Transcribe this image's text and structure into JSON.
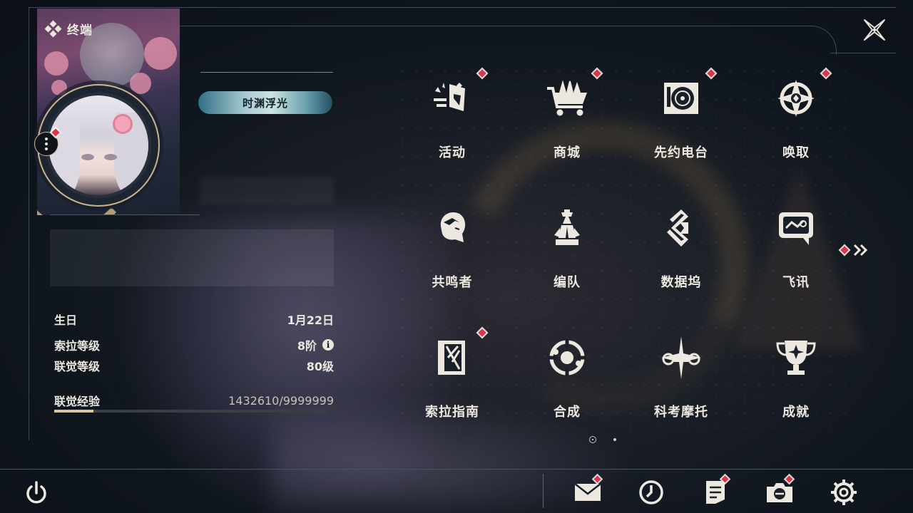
{
  "header": {
    "terminal_title": "终端"
  },
  "profile": {
    "title_badge": "时渊浮光",
    "stats": [
      {
        "key": "生日",
        "value": "1月22日"
      },
      {
        "key": "索拉等级",
        "value": "8阶"
      },
      {
        "key": "联觉等级",
        "value": "80级"
      }
    ],
    "exp": {
      "label": "联觉经验",
      "value": "1432610/9999999",
      "progress": 0.1433
    }
  },
  "menu": [
    {
      "label": "活动",
      "icon": "activity-icon",
      "badge": true
    },
    {
      "label": "商城",
      "icon": "shop-cart-icon",
      "badge": true
    },
    {
      "label": "先约电台",
      "icon": "radio-vinyl-icon",
      "badge": true
    },
    {
      "label": "唤取",
      "icon": "compass-star-icon",
      "badge": true
    },
    {
      "label": "共鸣者",
      "icon": "resonator-portrait-icon",
      "badge": false
    },
    {
      "label": "编队",
      "icon": "chess-team-icon",
      "badge": false
    },
    {
      "label": "数据坞",
      "icon": "data-dock-icon",
      "badge": false
    },
    {
      "label": "飞讯",
      "icon": "chat-bubble-icon",
      "badge": false
    },
    {
      "label": "索拉指南",
      "icon": "guide-book-icon",
      "badge": true
    },
    {
      "label": "合成",
      "icon": "synthesis-icon",
      "badge": false
    },
    {
      "label": "科考摩托",
      "icon": "motorbike-icon",
      "badge": false
    },
    {
      "label": "成就",
      "icon": "trophy-icon",
      "badge": false
    }
  ],
  "pagination": {
    "current": 1,
    "total": 2
  },
  "colors": {
    "accent_gold": "#c9b68f",
    "badge_red": "#d9364a",
    "text": "#ece8df",
    "background": "#10161e"
  },
  "bottom_bar": {
    "left": "power-icon",
    "right": [
      "mail-icon",
      "clock-icon",
      "notes-icon",
      "camera-icon",
      "settings-gear-icon"
    ]
  }
}
